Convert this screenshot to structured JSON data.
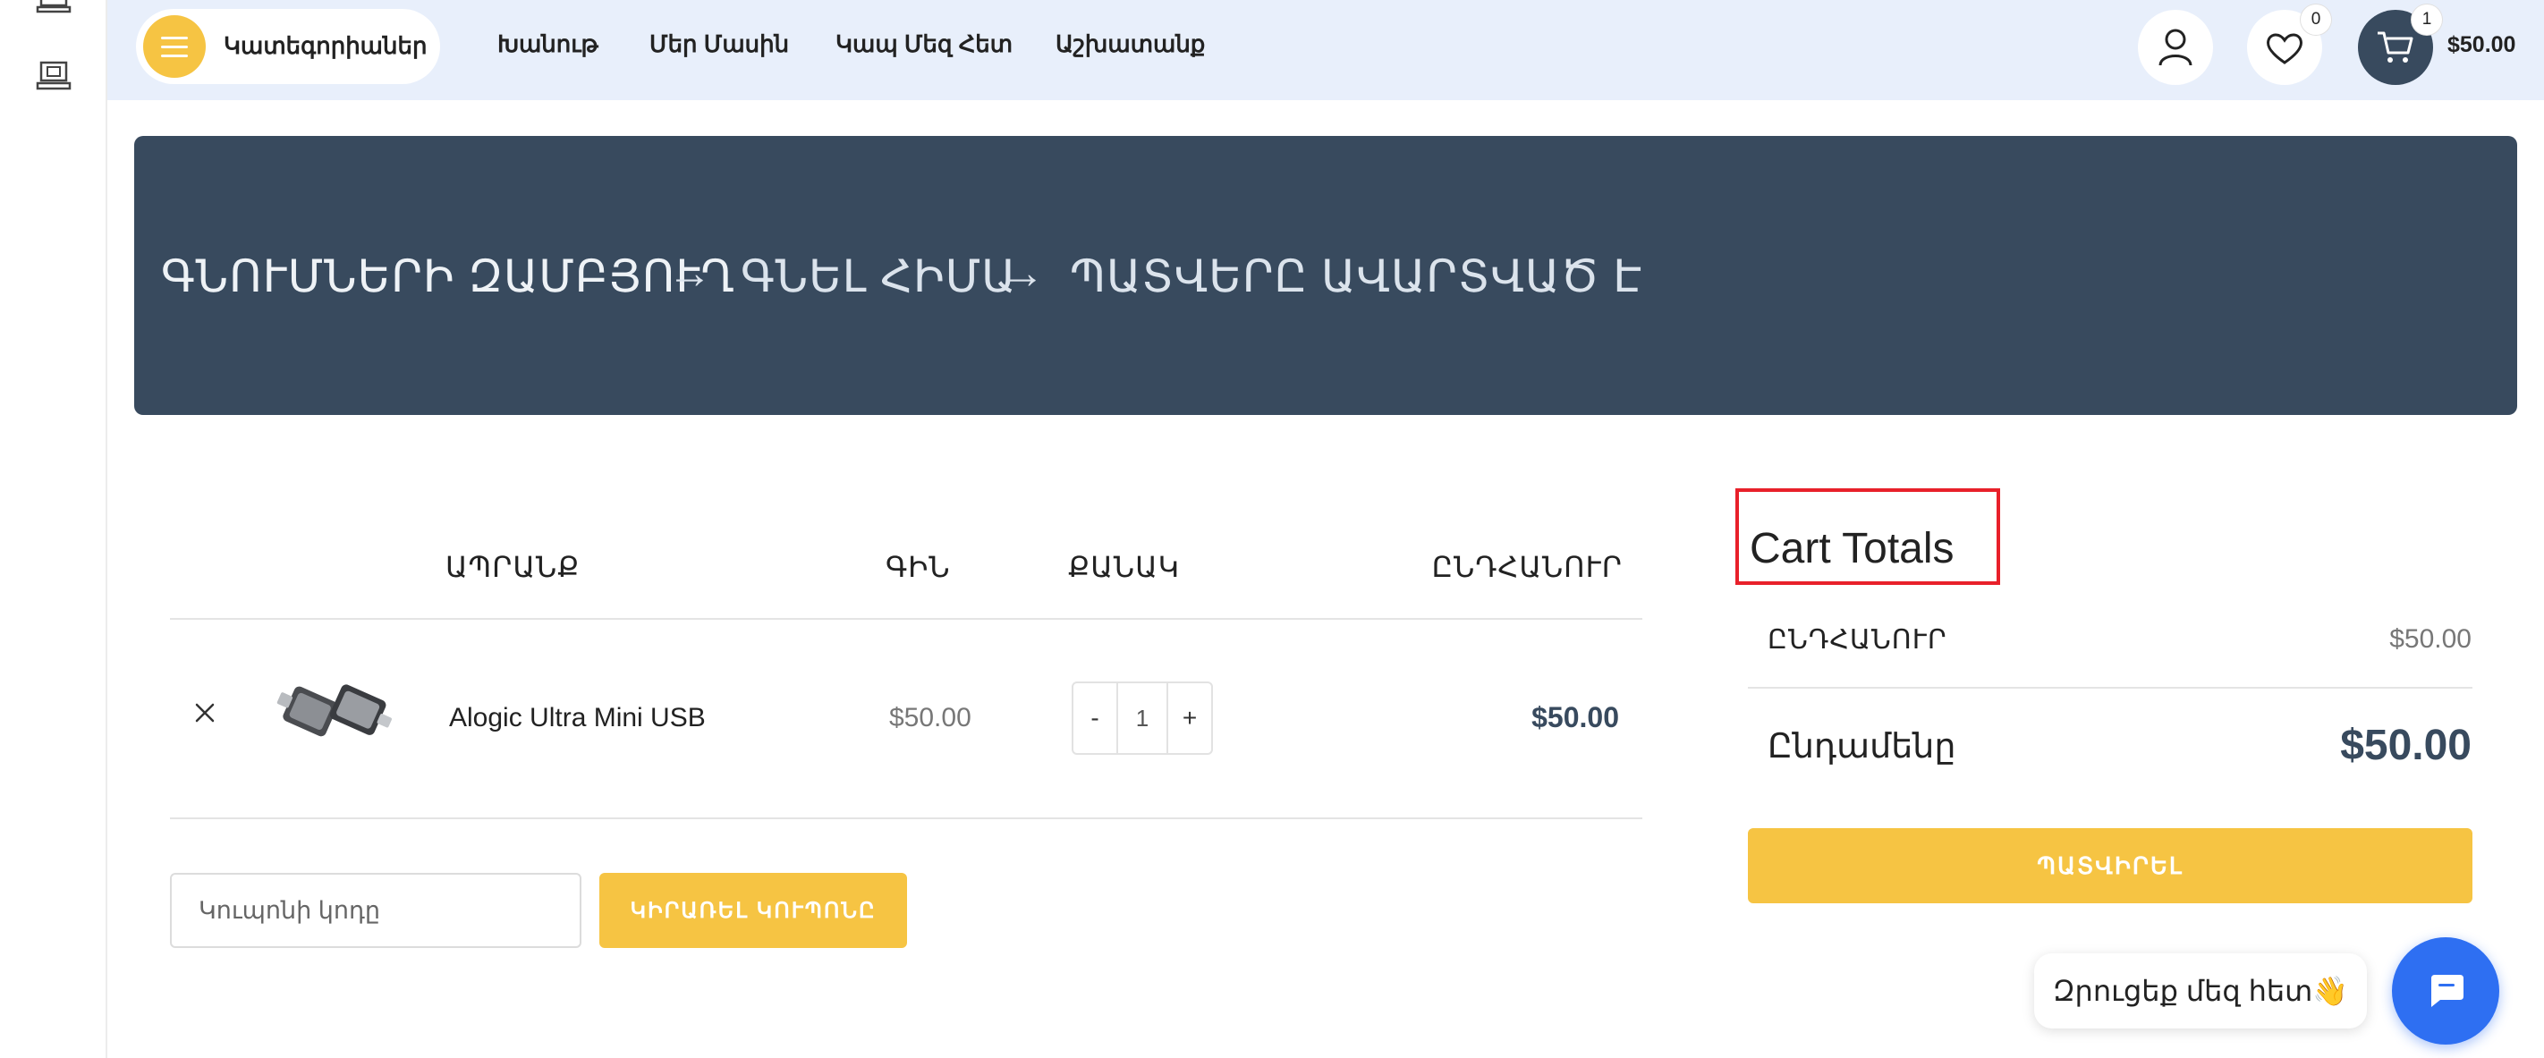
{
  "header": {
    "categories_label": "Կատեգորիաներ",
    "nav": [
      "Խանութ",
      "Մեր Մասին",
      "Կապ Մեզ Հետ",
      "Աշխատանք"
    ],
    "wishlist_count": "0",
    "cart_count": "1",
    "cart_amount": "$50.00"
  },
  "breadcrumb": {
    "step1": "ԳՆՈՒՄՆԵՐԻ ԶԱՄԲՅՈՒՂ",
    "arrow": "→",
    "step2": "ԳՆԵԼ ՀԻՄԱ",
    "step3": "ՊԱՏՎԵՐԸ ԱՎԱՐՏՎԱԾ Է"
  },
  "cart_table": {
    "headers": {
      "product": "ԱՊՐԱՆՔ",
      "price": "ԳԻՆ",
      "quantity": "ՔԱՆԱԿ",
      "total": "ԸՆԴՀԱՆՈՒՐ"
    },
    "items": [
      {
        "name": "Alogic Ultra Mini USB",
        "price": "$50.00",
        "qty": "1",
        "total": "$50.00",
        "minus": "-",
        "plus": "+"
      }
    ]
  },
  "coupon": {
    "placeholder": "Կուպոնի կոդը",
    "apply_label": "ԿԻՐԱՌԵԼ ԿՈՒՊՈՆԸ"
  },
  "totals": {
    "title": "Cart Totals",
    "subtotal_label": "ԸՆԴՀԱՆՈՒՐ",
    "subtotal_value": "$50.00",
    "total_label": "Ընդամենը",
    "total_value": "$50.00",
    "checkout_label": "ՊԱՏՎԻՐԵԼ"
  },
  "chat": {
    "bubble_text": "Զրուցեք մեզ հետ👋"
  },
  "colors": {
    "accent": "#f6c443",
    "dark": "#384a5e",
    "header_bg": "#e8effb",
    "chat_blue": "#2e6ff2",
    "highlight": "#e8202a"
  }
}
